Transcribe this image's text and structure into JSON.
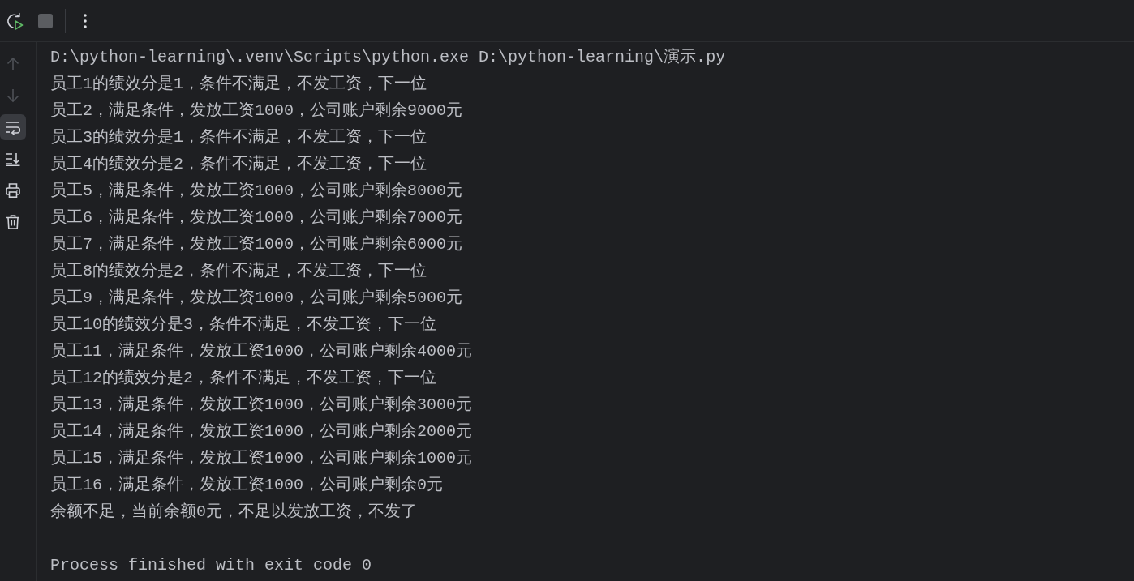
{
  "toolbar": [
    {
      "disabled": false
    },
    {
      "disabled": true
    },
    {
      "disabled": false
    }
  ],
  "side_tools": [
    {
      "disabled": true,
      "on": false
    },
    {
      "disabled": true,
      "on": false
    },
    {
      "disabled": false,
      "on": true
    },
    {
      "disabled": false,
      "on": false
    },
    {
      "disabled": false,
      "on": false
    },
    {
      "disabled": false,
      "on": false
    }
  ],
  "console": {
    "command": "D:\\python-learning\\.venv\\Scripts\\python.exe D:\\python-learning\\演示.py",
    "output": [
      "员工1的绩效分是1，条件不满足，不发工资，下一位",
      "员工2，满足条件，发放工资1000，公司账户剩余9000元",
      "员工3的绩效分是1，条件不满足，不发工资，下一位",
      "员工4的绩效分是2，条件不满足，不发工资，下一位",
      "员工5，满足条件，发放工资1000，公司账户剩余8000元",
      "员工6，满足条件，发放工资1000，公司账户剩余7000元",
      "员工7，满足条件，发放工资1000，公司账户剩余6000元",
      "员工8的绩效分是2，条件不满足，不发工资，下一位",
      "员工9，满足条件，发放工资1000，公司账户剩余5000元",
      "员工10的绩效分是3，条件不满足，不发工资，下一位",
      "员工11，满足条件，发放工资1000，公司账户剩余4000元",
      "员工12的绩效分是2，条件不满足，不发工资，下一位",
      "员工13，满足条件，发放工资1000，公司账户剩余3000元",
      "员工14，满足条件，发放工资1000，公司账户剩余2000元",
      "员工15，满足条件，发放工资1000，公司账户剩余1000元",
      "员工16，满足条件，发放工资1000，公司账户剩余0元",
      "余额不足，当前余额0元，不足以发放工资，不发了"
    ],
    "exit_message": "Process finished with exit code 0"
  }
}
